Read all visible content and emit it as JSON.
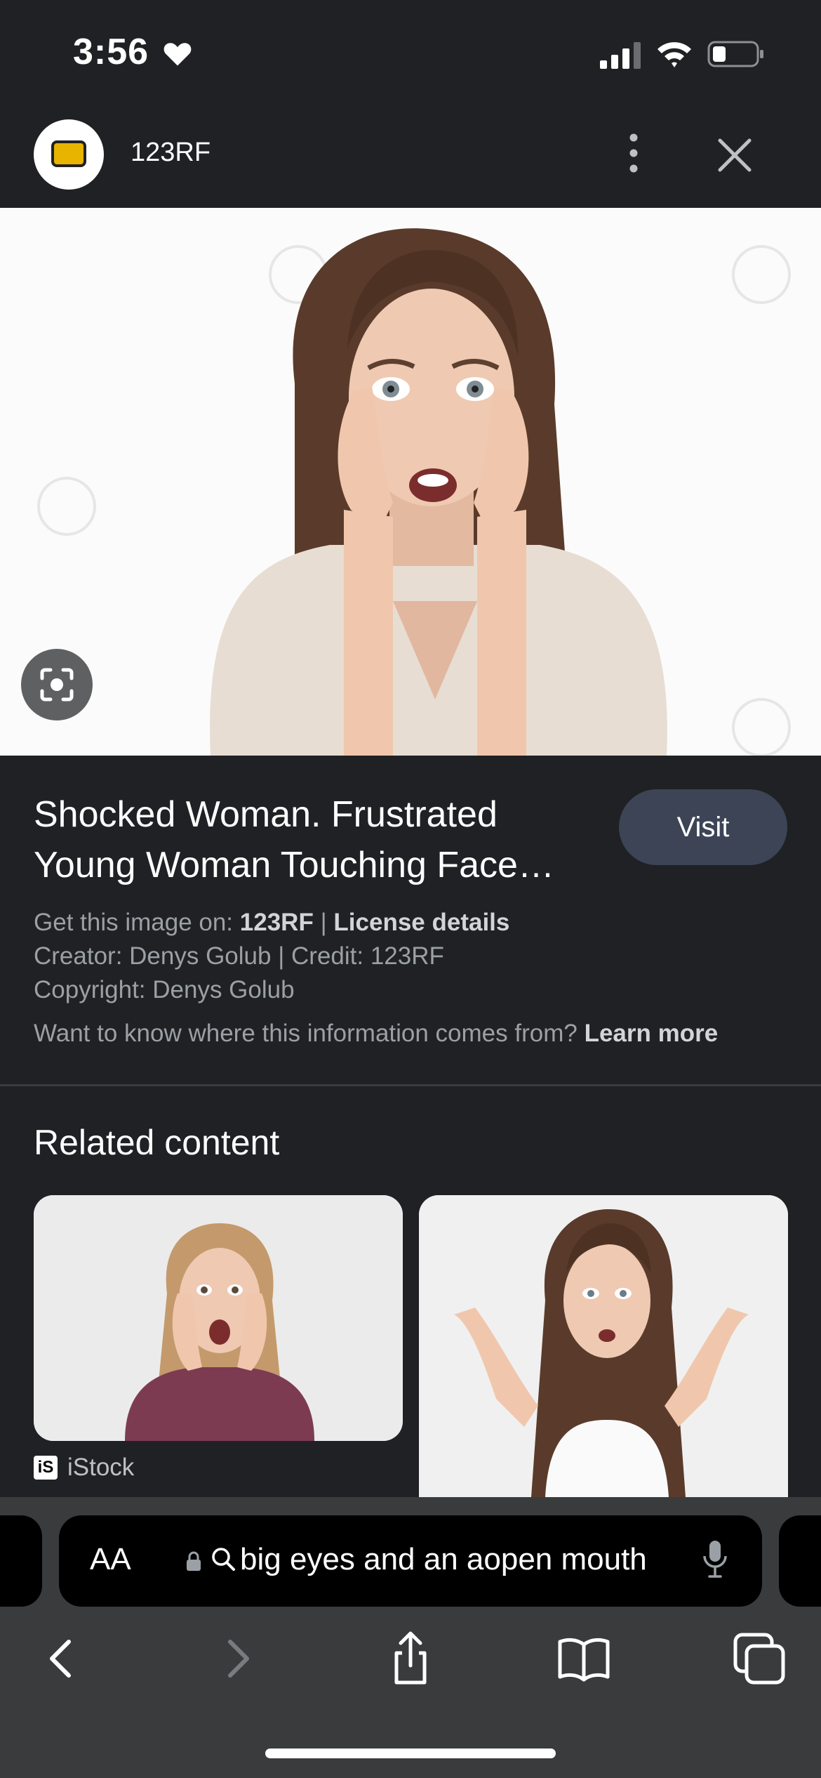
{
  "status_bar": {
    "time": "3:56"
  },
  "header": {
    "site_name": "123RF"
  },
  "result": {
    "title_line1": "Shocked Woman. Frustrated",
    "title_line2": "Young Woman Touching Face…",
    "visit_label": "Visit",
    "get_image_prefix": "Get this image on:",
    "source": "123RF",
    "separator": "|",
    "license_label": "License details",
    "creator_line": "Creator: Denys Golub | Credit: 123RF",
    "copyright_line": "Copyright: Denys Golub",
    "info_question": "Want to know where this information comes from?",
    "learn_more_label": "Learn more"
  },
  "related": {
    "heading": "Related content",
    "cards": [
      {
        "source_name": "iStock",
        "source_logo": "iS"
      },
      {
        "source_name": ""
      }
    ]
  },
  "address_bar": {
    "aa_label": "AA",
    "query": "big eyes and an aopen mouth"
  },
  "colors": {
    "background": "#202124",
    "visit_button": "#3c4456",
    "toolbar": "#3a3b3d"
  }
}
